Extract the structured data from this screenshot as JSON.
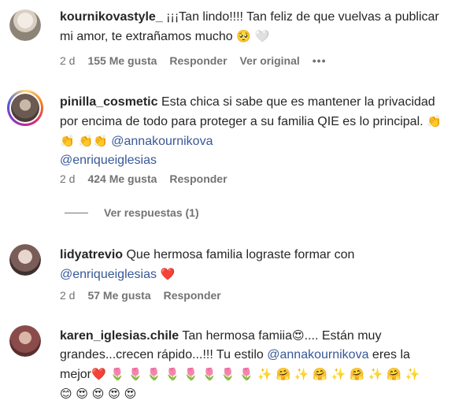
{
  "comments": [
    {
      "username": "kournikovastyle_",
      "text": " ¡¡¡Tan lindo!!!! Tan feliz de que vuelvas a publicar mi amor, te extrañamos mucho ",
      "emojis": "🥺 🤍",
      "time": "2 d",
      "likes": "155 Me gusta",
      "reply": "Responder",
      "original": "Ver original",
      "more": "•••"
    },
    {
      "username": "pinilla_cosmetic",
      "text": " Esta chica si sabe que es mantener la privacidad por encima de todo para proteger a su familia QIE es lo principal. ",
      "emojis": "👏👏 👏👏",
      "mentions": [
        "@annakournikova",
        "@enriqueiglesias"
      ],
      "time": "2 d",
      "likes": "424 Me gusta",
      "reply": "Responder",
      "view_replies": "Ver respuestas (1)"
    },
    {
      "username": "lidyatrevio",
      "text": " Que hermosa familia lograste formar con ",
      "mention": "@enriqueiglesias",
      "emoji": "❤️",
      "time": "2 d",
      "likes": "57 Me gusta",
      "reply": "Responder"
    },
    {
      "username": "karen_iglesias.chile",
      "text_before": " Tan hermosa famiia",
      "emoji_eyes": "😍",
      "text_mid": ".... Están muy grandes...crecen rápido...!!! Tu estilo ",
      "mention": "@annakournikova",
      "text_after": " eres la mejor",
      "emoji_line": "❤️ 🌷 🌷 🌷 🌷 🌷 🌷 🌷 🌷 ✨ 🤗 ✨ 🤗 ✨ 🤗 ✨ 🤗 ✨",
      "emoji_line2": "😊 😍 😍 😍 😍"
    }
  ]
}
